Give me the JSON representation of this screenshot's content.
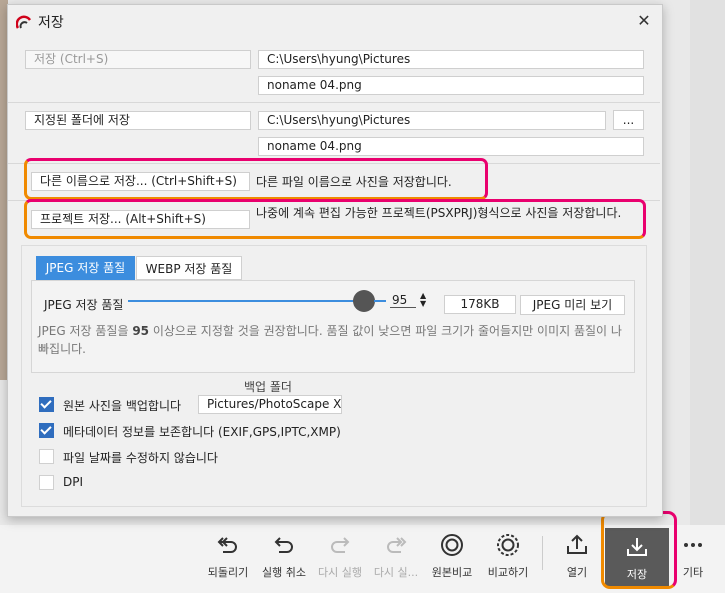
{
  "dialog": {
    "title": "저장",
    "close_label": "✕"
  },
  "save_ctrl": {
    "button_label": "저장  (Ctrl+S)",
    "folder": "C:\\Users\\hyung\\Pictures",
    "filename": "noname 04.png"
  },
  "save_folder": {
    "button_label": "지정된 폴더에 저장",
    "folder": "C:\\Users\\hyung\\Pictures",
    "browse_label": "...",
    "filename": "noname 04.png"
  },
  "save_as": {
    "button_label": "다른 이름으로 저장...  (Ctrl+Shift+S)",
    "description": "다른 파일 이름으로 사진을 저장합니다."
  },
  "project": {
    "button_label": "프로젝트 저장...  (Alt+Shift+S)",
    "description": "나중에 계속 편집 가능한 프로젝트(PSXPRJ)형식으로 사진을 저장합니다."
  },
  "quality": {
    "tabs": [
      "JPEG 저장 품질",
      "WEBP 저장 품질"
    ],
    "active_tab": 0,
    "label": "JPEG 저장 품질",
    "value": "95",
    "level": 95,
    "size": "178KB",
    "preview_label": "JPEG 미리 보기",
    "note_prefix": "JPEG 저장 품질을 ",
    "note_value": "95",
    "note_suffix": " 이상으로 지정할 것을 권장합니다. 품질 값이 낮으면 파일 크기가 줄어들지만 이미지 품질이 나빠집니다."
  },
  "backup": {
    "caption": "백업 폴더",
    "folder": "Pictures/PhotoScape X"
  },
  "options": [
    {
      "label": "원본 사진을 백업합니다",
      "checked": true
    },
    {
      "label": "메타데이터 정보를 보존합니다 (EXIF,GPS,IPTC,XMP)",
      "checked": true
    },
    {
      "label": "파일 날짜를 수정하지 않습니다",
      "checked": false
    },
    {
      "label": "DPI",
      "checked": false
    }
  ],
  "toolbar": {
    "items": [
      {
        "label": "되돌리기",
        "icon": "undo-all-icon",
        "enabled": true
      },
      {
        "label": "실행 취소",
        "icon": "undo-icon",
        "enabled": true
      },
      {
        "label": "다시 실행",
        "icon": "redo-icon",
        "enabled": false
      },
      {
        "label": "다시 실...",
        "icon": "redo-all-icon",
        "enabled": false
      },
      {
        "label": "원본비교",
        "icon": "compare-original-icon",
        "enabled": true
      },
      {
        "label": "비교하기",
        "icon": "compare-icon",
        "enabled": true
      },
      {
        "label": "열기",
        "icon": "open-icon",
        "enabled": true
      },
      {
        "label": "저장",
        "icon": "save-icon",
        "enabled": true
      },
      {
        "label": "기타",
        "icon": "more-icon",
        "enabled": true
      }
    ]
  },
  "colors": {
    "accent": "#3c8dde",
    "highlight_pink": "#e9006e",
    "highlight_orange": "#f08a00",
    "save_button": "#5a5a5a"
  }
}
